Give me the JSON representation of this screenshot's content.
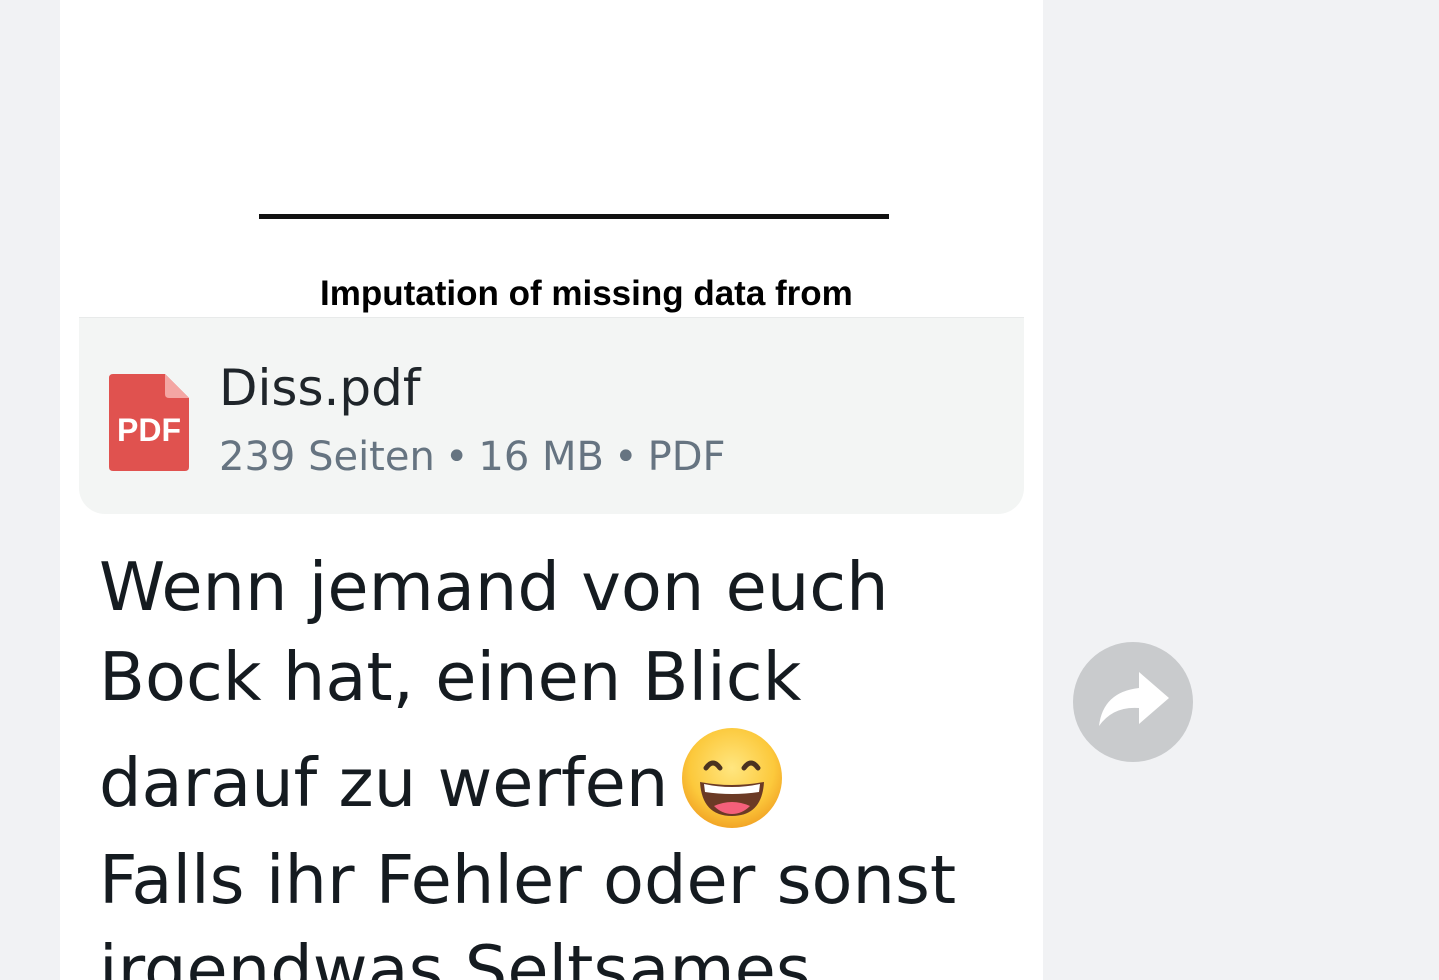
{
  "preview": {
    "title_snippet": "Imputation of missing data from"
  },
  "file": {
    "icon_label": "PDF",
    "icon_name": "pdf-file-icon",
    "name": "Diss.pdf",
    "pages": "239 Seiten",
    "size": "16 MB",
    "type": "PDF",
    "separator": "•"
  },
  "message": {
    "line1": "Wenn jemand von euch",
    "line2": "Bock hat, einen Blick",
    "line3": "darauf zu werfen",
    "emoji": "grinning-face-with-smiling-eyes",
    "line4": "Falls ihr Fehler oder sonst",
    "line5": "irgendwas Seltsames"
  },
  "actions": {
    "forward_icon": "forward-arrow-icon"
  },
  "colors": {
    "background": "#f1f2f4",
    "bubble": "#ffffff",
    "file_card": "#f3f5f4",
    "pdf_red": "#e0524f",
    "meta_text": "#667481",
    "forward_button": "#c9cbcd"
  }
}
